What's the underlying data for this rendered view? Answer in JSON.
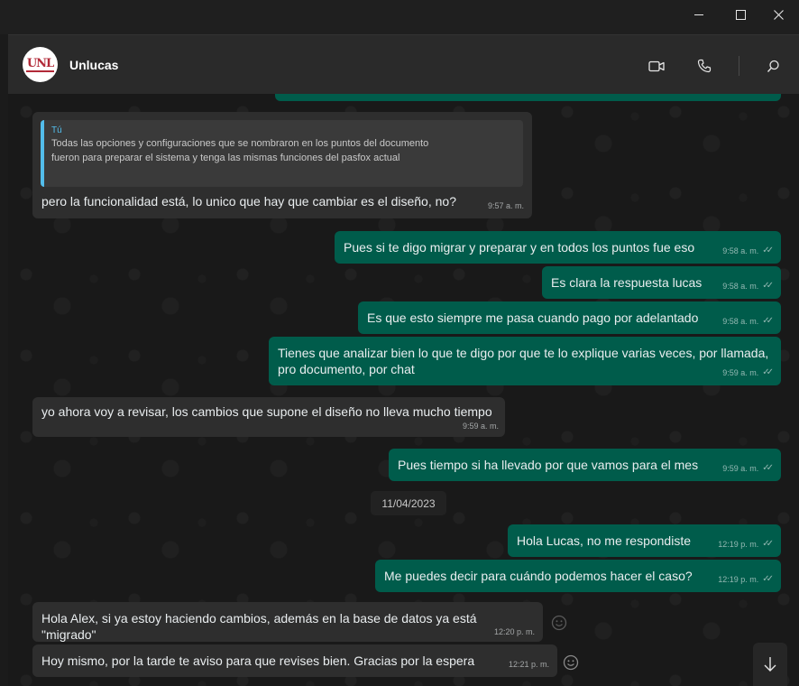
{
  "window": {
    "minimize_icon": "minimize-icon",
    "maximize_icon": "maximize-icon",
    "close_icon": "close-icon"
  },
  "header": {
    "contact_name": "Unlucas",
    "avatar_text": "UNL",
    "icons": [
      "video-call-icon",
      "voice-call-icon",
      "search-icon"
    ]
  },
  "quoted": {
    "author": "Tú",
    "text": "Todas las opciones y configuraciones que se nombraron en los puntos del documento fueron para preparar el sistema y tenga las mismas funciones del pasfox actual"
  },
  "messages": [
    {
      "direction": "in",
      "text": "pero la funcionalidad está, lo unico que hay que cambiar es el diseño, no?",
      "time": "9:57 a. m."
    },
    {
      "direction": "out",
      "text": "Pues si te digo migrar y preparar y en todos los puntos fue eso",
      "time": "9:58 a. m.",
      "status": "read"
    },
    {
      "direction": "out",
      "text": "Es clara la respuesta lucas",
      "time": "9:58 a. m.",
      "status": "read"
    },
    {
      "direction": "out",
      "text": "Es que esto siempre me pasa cuando pago por adelantado",
      "time": "9:58 a. m.",
      "status": "read"
    },
    {
      "direction": "out",
      "text": "Tienes que analizar bien lo que te digo por que te lo explique varias veces, por llamada, pro documento, por chat",
      "time": "9:59 a. m.",
      "status": "read"
    },
    {
      "direction": "in",
      "text": "yo ahora voy a revisar, los cambios que supone el diseño no lleva mucho tiempo",
      "time": "9:59 a. m."
    },
    {
      "direction": "out",
      "text": "Pues tiempo si ha llevado por que vamos para el mes",
      "time": "9:59 a. m.",
      "status": "read"
    },
    {
      "direction": "out",
      "text": "Hola Lucas, no me respondiste",
      "time": "12:19 p. m.",
      "status": "read"
    },
    {
      "direction": "out",
      "text": "Me puedes decir para cuándo podemos hacer el caso?",
      "time": "12:19 p. m.",
      "status": "read"
    },
    {
      "direction": "in",
      "text": "Hola Alex, si ya estoy haciendo cambios, además en la base de datos ya está \"migrado\"",
      "time": "12:20 p. m."
    },
    {
      "direction": "in",
      "text": "Hoy mismo, por la tarde te aviso para que revises bien. Gracias por la espera",
      "time": "12:21 p. m."
    }
  ],
  "date_separator": "11/04/2023",
  "ticks": "✓✓",
  "colors": {
    "incoming": "#2e2e2e",
    "outgoing": "#005c4b",
    "accent": "#53bdeb"
  }
}
